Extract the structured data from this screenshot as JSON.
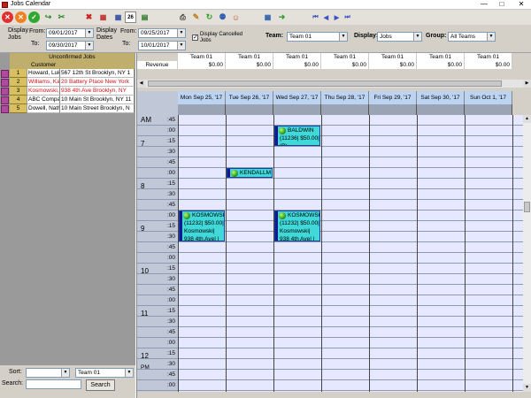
{
  "window": {
    "title": "Jobs Calendar",
    "minimize": "—",
    "maximize": "□",
    "close": "✕"
  },
  "toolbar": {
    "icons": [
      "cancel-red-icon",
      "cancel-orange-icon",
      "ok-green-icon",
      "refresh-arrow-icon",
      "tools-icon",
      "delete-x-icon",
      "calendar-x-icon",
      "calendar-month-icon",
      "calendar-day-icon",
      "calendar-export-icon",
      "printer-icon",
      "tag-icon",
      "refresh-green-icon",
      "user-add-icon",
      "contact-icon",
      "grid-icon",
      "export-arrow-icon",
      "first-nav-icon",
      "prev-nav-icon",
      "next-nav-icon",
      "last-nav-icon"
    ],
    "day_badge": "26"
  },
  "filter": {
    "display_jobs_label": "Display\nJobs",
    "from_label": "From:",
    "to_label": "To:",
    "jobs_from": "09/01/2017",
    "jobs_to": "09/30/2017",
    "display_dates_label": "Display\nDates",
    "dates_from_label": "From:",
    "dates_to_label": "To:",
    "dates_from": "09/25/2017",
    "dates_to": "10/01/2017",
    "display_cancelled_label": "Display Cancelled\nJobs",
    "display_cancelled_checked": true,
    "team_label": "Team:",
    "team_value": "Team 01",
    "display_label": "Display:",
    "display_value": "Jobs",
    "group_label": "Group:",
    "group_value": "All Teams"
  },
  "unconfirmed": {
    "title": "Unconfirmed Jobs",
    "column": "Customer",
    "rows": [
      {
        "num": "1",
        "customer": "Howard, Luk",
        "address": "567 12th St Brooklyn, NY 1",
        "red": false
      },
      {
        "num": "2",
        "customer": "Williams, Kat",
        "address": "20 Battery Place New York",
        "red": true
      },
      {
        "num": "3",
        "customer": "Kosmowski,",
        "address": "938 4th Ave Brooklyn, NY",
        "red": true
      },
      {
        "num": "4",
        "customer": "ABC Compar",
        "address": "10 Main St Brooklyn, NY 11",
        "red": false
      },
      {
        "num": "5",
        "customer": "Dowell, Nath",
        "address": "10 Main Street Brooklyn, N",
        "red": false
      }
    ]
  },
  "bottom": {
    "sort_label": "Sort:",
    "search_label": "Search:",
    "team_value": "Team 01",
    "search_button": "Search"
  },
  "revenue": {
    "label": "Revenue",
    "teams": [
      "Team 01",
      "Team 01",
      "Team 01",
      "Team 01",
      "Team 01",
      "Team 01",
      "Team 01"
    ],
    "values": [
      "$0.00",
      "$0.00",
      "$0.00",
      "$0.00",
      "$0.00",
      "$0.00",
      "$0.00"
    ]
  },
  "calendar": {
    "days": [
      "Mon Sep 25, '17",
      "Tue Sep 26, '17",
      "Wed Sep 27, '17",
      "Thu Sep 28, '17",
      "Fri Sep 29, '17",
      "Sat Sep 30, '17",
      "Sun Oct 1, '17"
    ],
    "hours": [
      {
        "label": "AM",
        "minutes": [
          ":45"
        ]
      },
      {
        "label": "7",
        "minutes": [
          ":00",
          ":15",
          ":30",
          ":45"
        ]
      },
      {
        "label": "8",
        "minutes": [
          ":00",
          ":15",
          ":30",
          ":45"
        ]
      },
      {
        "label": "9",
        "minutes": [
          ":00",
          ":15",
          ":30",
          ":45"
        ]
      },
      {
        "label": "10",
        "minutes": [
          ":00",
          ":15",
          ":30",
          ":45"
        ]
      },
      {
        "label": "11",
        "minutes": [
          ":00",
          ":15",
          ":30",
          ":45"
        ]
      },
      {
        "label": "12",
        "sub": "PM",
        "minutes": [
          ":00",
          ":15",
          ":30",
          ":45"
        ]
      },
      {
        "label": "",
        "minutes": [
          ":00",
          ":15"
        ]
      }
    ],
    "appointments": [
      {
        "name": "BALDWIN",
        "lines": [
          "(11236| $50.00|",
          "(P)"
        ],
        "day": 2,
        "start": "8:00",
        "end": "8:30"
      },
      {
        "name": "KENDALLM",
        "lines": [],
        "day": 1,
        "start": "9:00",
        "end": "9:15"
      },
      {
        "name": "KOSMOWSK",
        "lines": [
          "(11232| $50.00|",
          "Kosmowski|",
          "938 4th Ave| |",
          "(P)"
        ],
        "day": 0,
        "start": "10:00",
        "end": "10:45"
      },
      {
        "name": "KOSMOWSK",
        "lines": [
          "(11232| $50.00|",
          "Kosmowski|",
          "938 4th Ave| |",
          "(P)"
        ],
        "day": 2,
        "start": "10:00",
        "end": "10:45"
      }
    ]
  },
  "colors": {
    "accent": "#10188c",
    "appointment": "#40d8d8",
    "grid_bg": "#e6e8ff",
    "day_header": "#bcd4f2",
    "unconfirmed_header": "#c0ae6c",
    "red_text": "#d0141a"
  }
}
